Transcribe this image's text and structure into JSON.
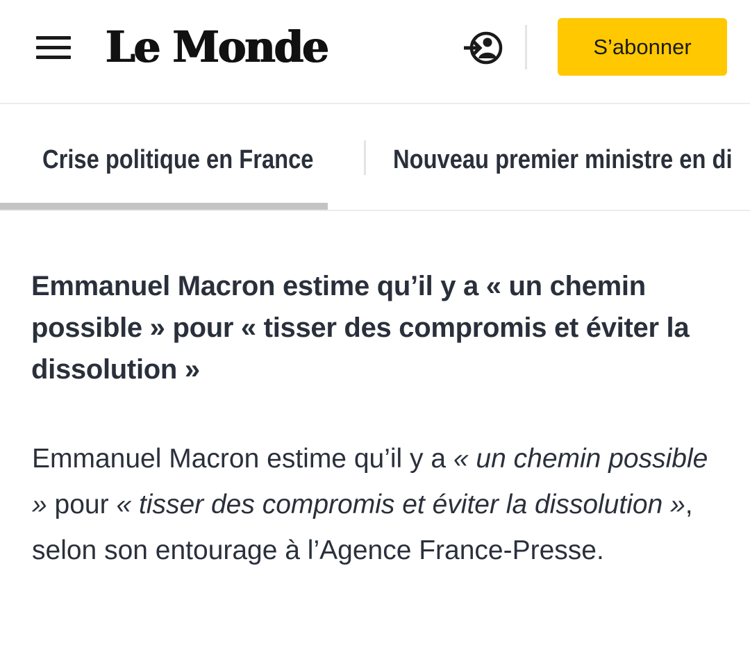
{
  "header": {
    "logo_text": "Le Monde",
    "login_icon": "login-user-icon",
    "menu_icon": "hamburger-menu-icon",
    "subscribe_label": "S’abonner",
    "accent_color": "#ffc800"
  },
  "tabs": [
    {
      "label": "Crise politique en France",
      "active": true
    },
    {
      "label": "Nouveau premier ministre en di",
      "active": false
    }
  ],
  "article": {
    "headline": "Emmanuel Macron estime qu’il y a « un chemin possible » pour « tisser des compromis et éviter la dissolution »",
    "body": {
      "part1": "Emmanuel Macron estime qu’il y a ",
      "quote1": "« un chemin possible »",
      "part2": " pour ",
      "quote2": "« tisser des compromis et éviter la dissolution »",
      "part3": ", selon son entourage à l’Agence France-Presse."
    }
  }
}
